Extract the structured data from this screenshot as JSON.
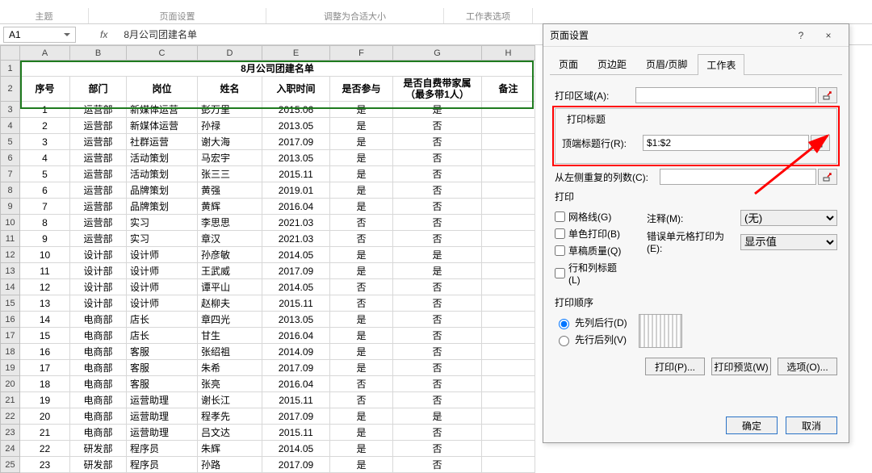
{
  "ribbon": {
    "groups": [
      "主题",
      "页面设置",
      "调整为合适大小",
      "工作表选项"
    ]
  },
  "namebox": "A1",
  "fx": "fx",
  "formula_text": "8月公司团建名单",
  "col_headers": [
    "A",
    "B",
    "C",
    "D",
    "E",
    "F",
    "G",
    "H"
  ],
  "title_cell": "8月公司团建名单",
  "table_headers": [
    "序号",
    "部门",
    "岗位",
    "姓名",
    "入职时间",
    "是否参与",
    "是否自费带家属\n（最多带1人）",
    "备注"
  ],
  "rows": [
    [
      "1",
      "运营部",
      "新媒体运营",
      "彭万里",
      "2015.06",
      "是",
      "是",
      ""
    ],
    [
      "2",
      "运营部",
      "新媒体运营",
      "孙禄",
      "2013.05",
      "是",
      "否",
      ""
    ],
    [
      "3",
      "运营部",
      "社群运营",
      "谢大海",
      "2017.09",
      "是",
      "否",
      ""
    ],
    [
      "4",
      "运营部",
      "活动策划",
      "马宏宇",
      "2013.05",
      "是",
      "否",
      ""
    ],
    [
      "5",
      "运营部",
      "活动策划",
      "张三三",
      "2015.11",
      "是",
      "否",
      ""
    ],
    [
      "6",
      "运营部",
      "品牌策划",
      "黄强",
      "2019.01",
      "是",
      "否",
      ""
    ],
    [
      "7",
      "运营部",
      "品牌策划",
      "黄辉",
      "2016.04",
      "是",
      "否",
      ""
    ],
    [
      "8",
      "运营部",
      "实习",
      "李思思",
      "2021.03",
      "否",
      "否",
      ""
    ],
    [
      "9",
      "运营部",
      "实习",
      "章汉",
      "2021.03",
      "否",
      "否",
      ""
    ],
    [
      "10",
      "设计部",
      "设计师",
      "孙彦敏",
      "2014.05",
      "是",
      "是",
      ""
    ],
    [
      "11",
      "设计部",
      "设计师",
      "王武威",
      "2017.09",
      "是",
      "是",
      ""
    ],
    [
      "12",
      "设计部",
      "设计师",
      "谭平山",
      "2014.05",
      "否",
      "否",
      ""
    ],
    [
      "13",
      "设计部",
      "设计师",
      "赵柳夫",
      "2015.11",
      "否",
      "否",
      ""
    ],
    [
      "14",
      "电商部",
      "店长",
      "章四光",
      "2013.05",
      "是",
      "否",
      ""
    ],
    [
      "15",
      "电商部",
      "店长",
      "甘生",
      "2016.04",
      "是",
      "否",
      ""
    ],
    [
      "16",
      "电商部",
      "客服",
      "张绍祖",
      "2014.09",
      "是",
      "否",
      ""
    ],
    [
      "17",
      "电商部",
      "客服",
      "朱希",
      "2017.09",
      "是",
      "否",
      ""
    ],
    [
      "18",
      "电商部",
      "客服",
      "张亮",
      "2016.04",
      "否",
      "否",
      ""
    ],
    [
      "19",
      "电商部",
      "运营助理",
      "谢长江",
      "2015.11",
      "否",
      "否",
      ""
    ],
    [
      "20",
      "电商部",
      "运营助理",
      "程孝先",
      "2017.09",
      "是",
      "是",
      ""
    ],
    [
      "21",
      "电商部",
      "运营助理",
      "吕文达",
      "2015.11",
      "是",
      "否",
      ""
    ],
    [
      "22",
      "研发部",
      "程序员",
      "朱辉",
      "2014.05",
      "是",
      "否",
      ""
    ],
    [
      "23",
      "研发部",
      "程序员",
      "孙路",
      "2017.09",
      "是",
      "否",
      ""
    ]
  ],
  "dialog": {
    "title": "页面设置",
    "help": "?",
    "close": "×",
    "tabs": [
      "页面",
      "页边距",
      "页眉/页脚",
      "工作表"
    ],
    "active_tab": 3,
    "print_area_label": "打印区域(A):",
    "print_titles_legend": "打印标题",
    "top_rows_label": "顶端标题行(R):",
    "top_rows_value": "$1:$2",
    "left_cols_label": "从左侧重复的列数(C):",
    "print_legend": "打印",
    "chk_gridlines": "网格线(G)",
    "chk_bw": "单色打印(B)",
    "chk_draft": "草稿质量(Q)",
    "chk_rowcol": "行和列标题(L)",
    "comments_label": "注释(M):",
    "comments_value": "(无)",
    "errors_label": "错误单元格打印为(E):",
    "errors_value": "显示值",
    "order_legend": "打印顺序",
    "radio_downover": "先列后行(D)",
    "radio_overdown": "先行后列(V)",
    "btn_print": "打印(P)...",
    "btn_preview": "打印预览(W)",
    "btn_options": "选项(O)...",
    "btn_ok": "确定",
    "btn_cancel": "取消"
  }
}
